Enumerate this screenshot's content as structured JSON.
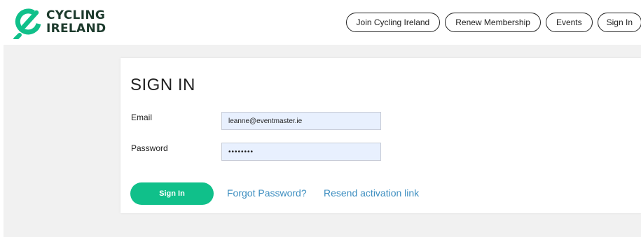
{
  "brand": {
    "line1": "CYCLING",
    "line2": "IRELAND",
    "logo_icon": "cycling-ireland-logo-icon",
    "accent_color": "#10c08a",
    "text_color": "#1c3a2c"
  },
  "nav": {
    "join": "Join Cycling Ireland",
    "renew": "Renew Membership",
    "events": "Events",
    "sign_in": "Sign In"
  },
  "form": {
    "title": "SIGN IN",
    "email_label": "Email",
    "email_value": "leanne@eventmaster.ie",
    "password_label": "Password",
    "password_value": "••••••••",
    "submit_label": "Sign In",
    "forgot_link": "Forgot Password?",
    "resend_link": "Resend activation link",
    "input_bg": "#e8f0fe",
    "link_color": "#3d8ec0"
  }
}
